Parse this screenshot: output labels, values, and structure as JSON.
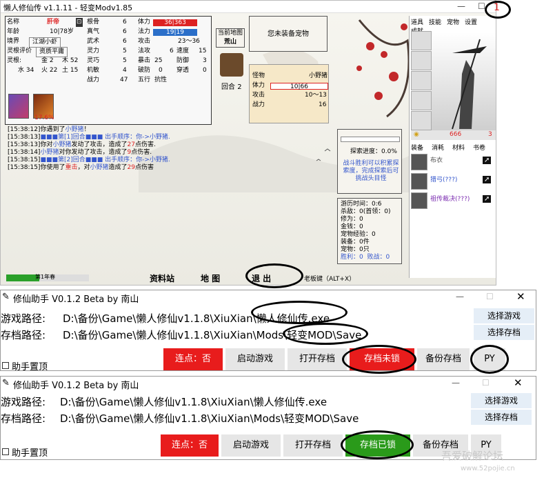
{
  "game": {
    "title": "懒人修仙传 v1.1.11 - 轻变Modv1.85",
    "window_min": "—",
    "window_max": "☐",
    "badge": "1",
    "stats": {
      "name_label": "名称",
      "name_value": "肝帝",
      "gender_icon": "⊡",
      "age_label": "年龄",
      "age_value": "10|78岁",
      "realm_label": "境界",
      "realm_value": "江湖小虾",
      "root_label": "灵根评价",
      "root_value": "资质平庸",
      "roots_label": "灵根:",
      "metal": "金  2",
      "wood": "木 52",
      "water": "水 34",
      "fire": "火 22",
      "earth": "土 15",
      "bone_label": "根骨",
      "bone_value": "6",
      "qi_label": "真气",
      "qi_value": "6",
      "wuli_label": "武术",
      "wuli_value": "6",
      "lingli_label": "灵力",
      "lingli_value": "5",
      "lingqiao_label": "灵巧",
      "lingqiao_value": "5",
      "jiqiao_label": "机敏",
      "jiqiao_value": "4",
      "zhanli_label": "战力",
      "zhanli_value": "47",
      "hp_label": "体力",
      "hp_value": "36|363",
      "mp_label": "法力",
      "mp_value": "19|19",
      "atk_label": "攻击",
      "atk_value": "23～36",
      "fd_label": "法攻",
      "fd_value": "6",
      "speed_label": "速度",
      "speed_value": "15",
      "crit_label": "暴击",
      "crit_value": "25",
      "def_label": "防御",
      "def_value": "3",
      "broken_label": "破防",
      "broken_value": "0",
      "pierce_label": "穿透",
      "pierce_value": "0",
      "wuxing_label": "五行",
      "wuxing_value": "抗性",
      "pct": "17.6%"
    },
    "map": {
      "label": "当前地图",
      "value": "荒山"
    },
    "pet": {
      "value": "您未装备宠物"
    },
    "round": {
      "label": "回合",
      "value": "2"
    },
    "enemy": {
      "monster_label": "怪物",
      "monster_value": "小野猪",
      "hp_label": "体力",
      "hp_value": "10|66",
      "atk_label": "攻击",
      "atk_value": "10～13",
      "power_label": "战力",
      "power_value": "16"
    },
    "log": [
      {
        "ts": "[15:38:12]",
        "parts": [
          {
            "c": "t",
            "s": "你遇到了"
          },
          {
            "c": "b",
            "s": "小野猪"
          },
          {
            "c": "t",
            "s": "！"
          }
        ]
      },
      {
        "ts": "[15:38:13]",
        "parts": [
          {
            "c": "b",
            "s": "■■■第[1]回合■■■  出手顺序：你->小野猪."
          }
        ]
      },
      {
        "ts": "[15:38:13]",
        "parts": [
          {
            "c": "t",
            "s": "你对"
          },
          {
            "c": "b",
            "s": "小野猪"
          },
          {
            "c": "t",
            "s": "发动了攻击，造成了"
          },
          {
            "c": "r",
            "s": "27"
          },
          {
            "c": "t",
            "s": "点伤害."
          }
        ]
      },
      {
        "ts": "[15:38:14]",
        "parts": [
          {
            "c": "b",
            "s": "小野猪"
          },
          {
            "c": "t",
            "s": "对你发动了攻击，造成了"
          },
          {
            "c": "r",
            "s": "9"
          },
          {
            "c": "t",
            "s": "点伤害."
          }
        ]
      },
      {
        "ts": "[15:38:15]",
        "parts": [
          {
            "c": "b",
            "s": "■■■第[2]回合■■■  出手顺序：你->小野猪."
          }
        ]
      },
      {
        "ts": "[15:38:15]",
        "parts": [
          {
            "c": "t",
            "s": "你使用了"
          },
          {
            "c": "r",
            "s": "重击"
          },
          {
            "c": "t",
            "s": "，对"
          },
          {
            "c": "b",
            "s": "小野猪"
          },
          {
            "c": "t",
            "s": "造成了"
          },
          {
            "c": "r",
            "s": "29"
          },
          {
            "c": "t",
            "s": "点伤害"
          }
        ]
      }
    ],
    "explore": {
      "progress": "探索进度：0.0%",
      "hint": "战斗胜利可以积累探索度，完成探索后可挑战头目怪",
      "hint_l1": "战斗胜利可以积累探",
      "hint_l2": "索度，完成探索后可",
      "hint_l3": "挑战头目怪"
    },
    "summary": [
      "游历时间：0:6",
      "杀敌：0(首领：0)",
      "修为：0",
      "金钱：0",
      "宠物经验：0",
      "装备：0件",
      "宠物：0只"
    ],
    "summary_win": "胜利：0",
    "summary_fail": "败战：0",
    "side_tabs": [
      "道具",
      "技能",
      "宠物",
      "设置",
      "成就"
    ],
    "gold": "666",
    "gold2": "3",
    "equip_tabs": [
      "装备",
      "消耗",
      "材料",
      "书卷"
    ],
    "equip_items": [
      {
        "name": "布衣",
        "color": "#555"
      },
      {
        "name": "猎弓(???)",
        "color": "#3355cc"
      },
      {
        "name": "祖传裁决(???)",
        "color": "#7a2bb0"
      }
    ],
    "season": "第1年春",
    "bottom_btns": [
      "资料站",
      "地  图",
      "退  出"
    ],
    "boss_key": "老板键（ALT+X）"
  },
  "helper1": {
    "title": "修仙助手 V0.1.2 Beta   by 南山",
    "game_label": "游戏路径:",
    "game_path": "D:\\备份\\Game\\懒人修仙v1.1.8\\XiuXian\\懒人修仙传.exe",
    "save_label": "存档路径:",
    "save_path": "D:\\备份\\Game\\懒人修仙v1.1.8\\XiuXian\\Mods\\轻变MOD\\Save",
    "select_game": "选择游戏",
    "select_save": "选择存档",
    "topmost": "助手置顶",
    "lianDian": "连点：否",
    "start": "启动游戏",
    "open_save": "打开存档",
    "lock": "存档未锁",
    "backup": "备份存档",
    "py": "PY",
    "lock_color": "#e81c1c"
  },
  "helper2": {
    "title": "修仙助手 V0.1.2 Beta   by 南山",
    "game_label": "游戏路径:",
    "game_path": "D:\\备份\\Game\\懒人修仙v1.1.8\\XiuXian\\懒人修仙传.exe",
    "save_label": "存档路径:",
    "save_path": "D:\\备份\\Game\\懒人修仙v1.1.8\\XiuXian\\Mods\\轻变MOD\\Save",
    "select_game": "选择游戏",
    "select_save": "选择存档",
    "topmost": "助手置顶",
    "lianDian": "连点：否",
    "start": "启动游戏",
    "open_save": "打开存档",
    "lock": "存档已锁",
    "backup": "备份存档",
    "py": "PY",
    "lock_color": "#2a9a1a"
  },
  "watermark": {
    "line1": "吾爱破解论坛",
    "line2": "www.52pojie.cn"
  },
  "colors": {
    "red": "#e81c1c",
    "green": "#2a9a1a",
    "select_bg": "#e5eef7"
  }
}
